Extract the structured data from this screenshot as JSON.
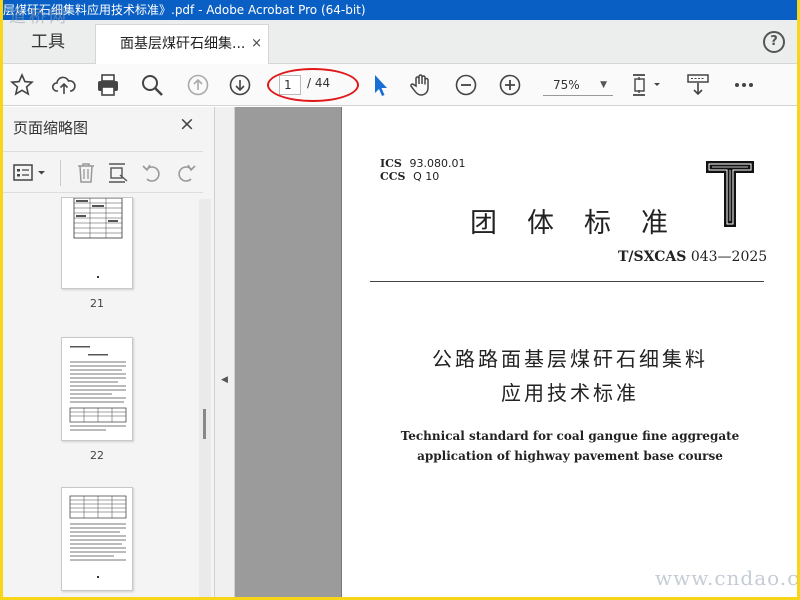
{
  "window": {
    "title": "层煤矸石细集料应用技术标准》.pdf - Adobe Acrobat Pro (64-bit)",
    "watermark_top": "道桥网",
    "watermark_bottom": "www.cndao.com"
  },
  "tabs": {
    "tools_label": "工具",
    "doc_label": "面基层煤矸石细集...",
    "close_glyph": "×",
    "help_glyph": "?"
  },
  "toolbar": {
    "icons": [
      "star-icon",
      "upload-icon",
      "print-icon",
      "zoom-search-icon",
      "page-up-icon",
      "page-down-icon",
      "select-cursor-icon",
      "hand-icon",
      "zoom-out-icon",
      "zoom-in-icon",
      "fit-page-icon",
      "scroll-mode-icon",
      "more-icon"
    ],
    "current_page": "1",
    "total_pages": "/ 44",
    "zoom": "75%",
    "annotation_color": "#e01818"
  },
  "sidebar": {
    "title": "页面缩略图",
    "close_glyph": "×",
    "thumbnails": [
      {
        "label": "21"
      },
      {
        "label": "22"
      },
      {
        "label": ""
      }
    ]
  },
  "document": {
    "ics": "ICS",
    "ics_code": "93.080.01",
    "ccs": "CCS",
    "ccs_code": "Q  10",
    "standard_type": "团体标准",
    "standard_no_prefix": "T/SXCAS",
    "standard_no": "043—2025",
    "title_cn_line1": "公路路面基层煤矸石细集料",
    "title_cn_line2": "应用技术标准",
    "title_en_line1": "Technical standard for coal gangue fine aggregate",
    "title_en_line2": "application of highway pavement base course"
  },
  "colors": {
    "titlebar": "#0a5fc4",
    "frame": "#f7d517",
    "select_tool": "#1a6fd6"
  }
}
